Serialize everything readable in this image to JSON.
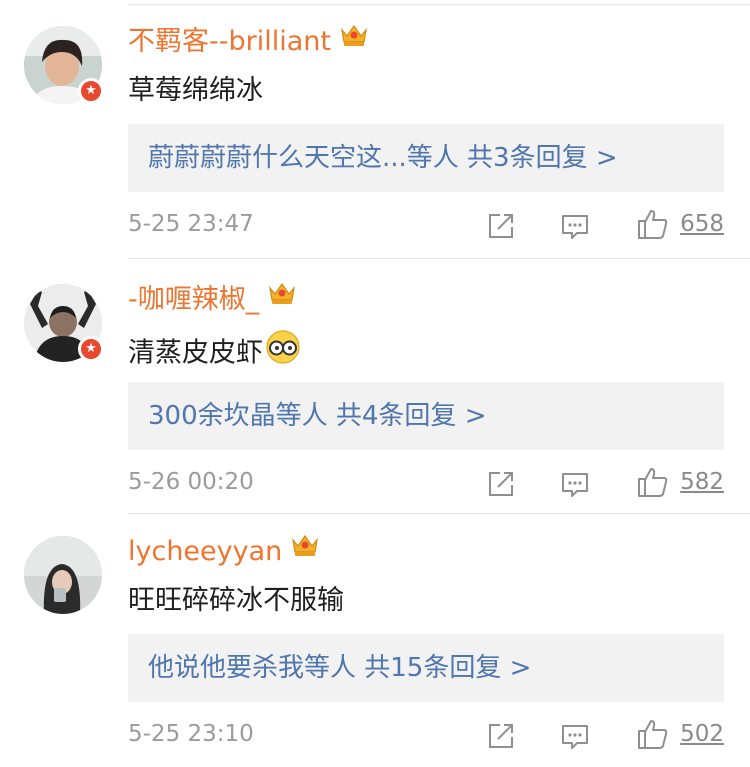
{
  "comments": [
    {
      "username": "不羁客--brilliant",
      "content": "草莓绵绵冰",
      "reply_summary": "蔚蔚蔚蔚什么天空这...等人  共3条回复 >",
      "timestamp": "5-25 23:47",
      "likes": "658",
      "verified": true
    },
    {
      "username": "-咖喱辣椒_",
      "content": "清蒸皮皮虾",
      "reply_summary": "300余坎晶等人  共4条回复 >",
      "timestamp": "5-26 00:20",
      "likes": "582",
      "verified": true
    },
    {
      "username": "lycheeyyan",
      "content": "旺旺碎碎冰不服输",
      "reply_summary": "他说他要杀我等人  共15条回复 >",
      "timestamp": "5-25 23:10",
      "likes": "502",
      "verified": false
    }
  ],
  "icons": {
    "share": "share-icon",
    "comment": "comment-icon",
    "like": "thumbs-up-icon",
    "member": "crown-badge-icon",
    "verified": "verified-badge-icon"
  },
  "colors": {
    "username": "#ee7530",
    "link": "#4f76ad",
    "meta": "#9b9b9b",
    "reply_bg": "#f2f2f2",
    "verified": "#e8482e",
    "crown": "#f5b12a"
  }
}
